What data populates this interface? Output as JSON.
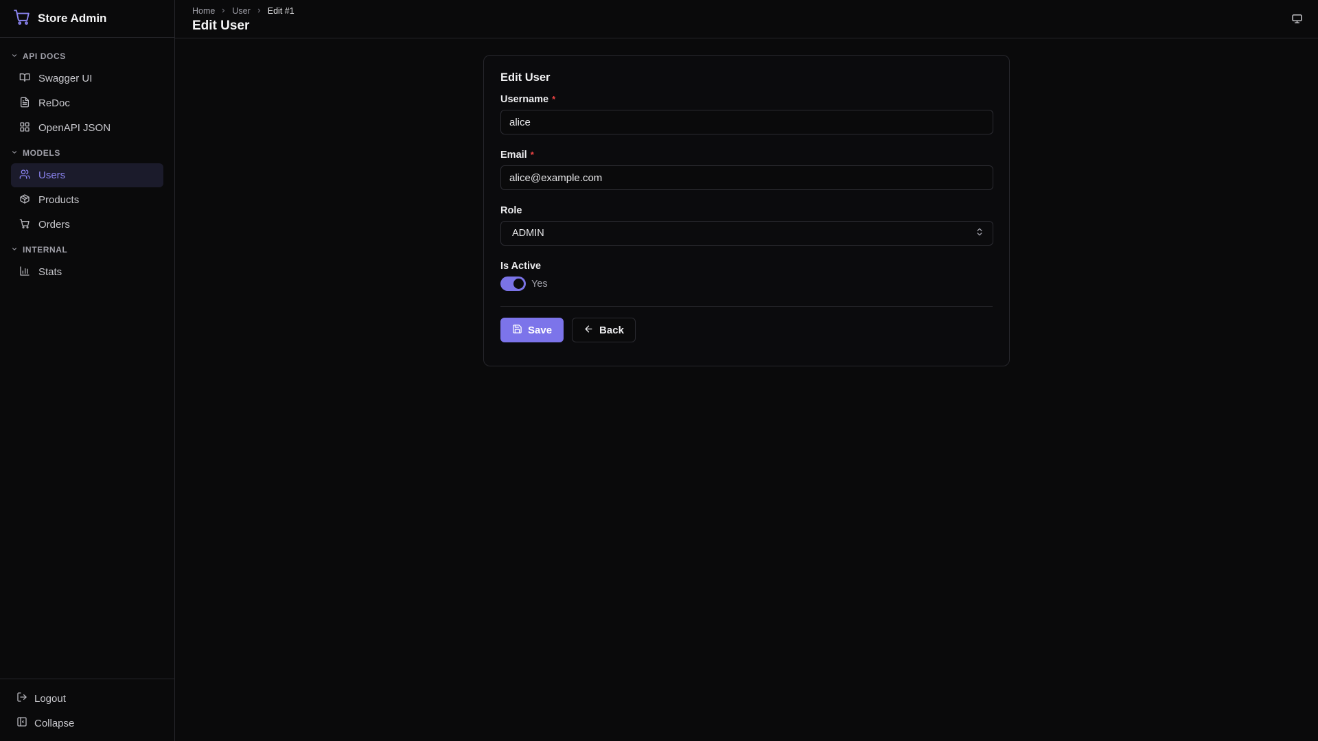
{
  "brand": {
    "title": "Store Admin",
    "icon": "cart-icon",
    "accent": "#7c74ea"
  },
  "sidebar": {
    "sections": [
      {
        "label": "API DOCS",
        "items": [
          {
            "label": "Swagger UI",
            "icon": "book-open-icon"
          },
          {
            "label": "ReDoc",
            "icon": "file-text-icon"
          },
          {
            "label": "OpenAPI JSON",
            "icon": "grid-icon"
          }
        ]
      },
      {
        "label": "MODELS",
        "items": [
          {
            "label": "Users",
            "icon": "users-icon",
            "active": true
          },
          {
            "label": "Products",
            "icon": "package-icon"
          },
          {
            "label": "Orders",
            "icon": "cart-icon"
          }
        ]
      },
      {
        "label": "INTERNAL",
        "items": [
          {
            "label": "Stats",
            "icon": "bar-chart-icon"
          }
        ]
      }
    ],
    "bottom": {
      "logout": "Logout",
      "collapse": "Collapse"
    }
  },
  "header": {
    "breadcrumb": [
      "Home",
      "User",
      "Edit #1"
    ],
    "title": "Edit User"
  },
  "form": {
    "title": "Edit User",
    "username": {
      "label": "Username",
      "value": "alice",
      "required": "*"
    },
    "email": {
      "label": "Email",
      "value": "alice@example.com",
      "required": "*"
    },
    "role": {
      "label": "Role",
      "value": "ADMIN"
    },
    "is_active": {
      "label": "Is Active",
      "value": true,
      "text": "Yes"
    },
    "save_label": "Save",
    "back_label": "Back"
  }
}
